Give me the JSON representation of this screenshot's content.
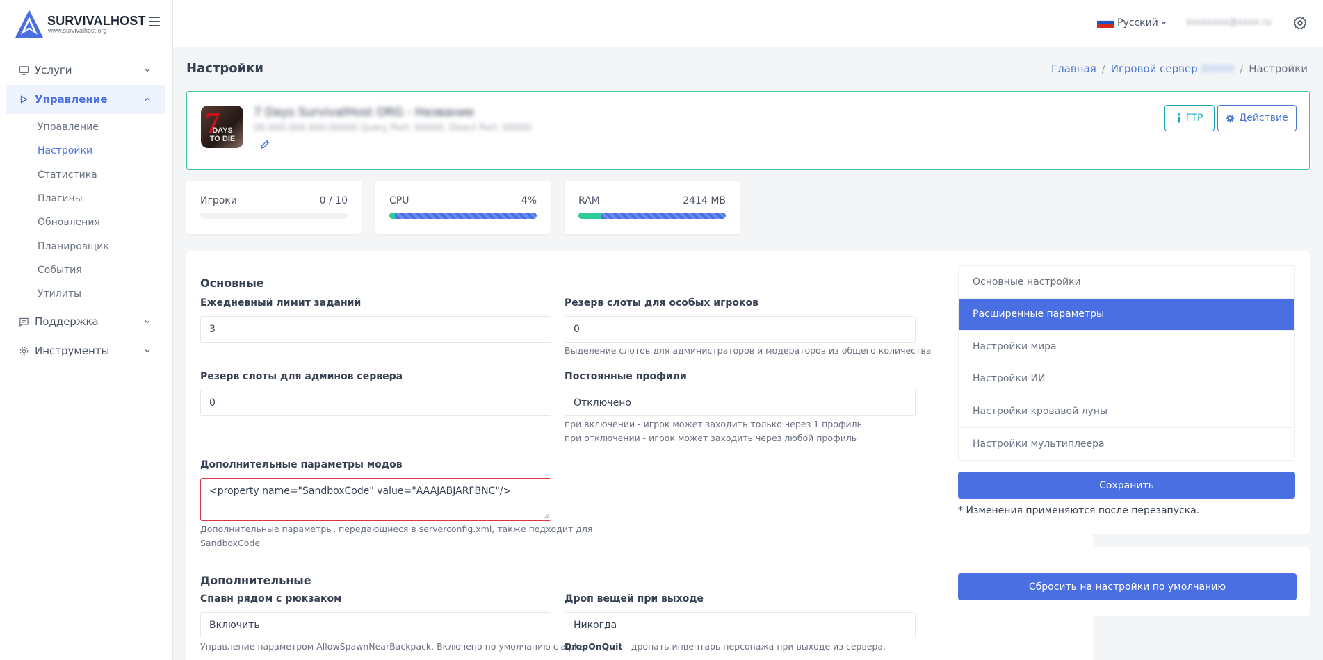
{
  "brand": {
    "name": "SURVIVALHOST",
    "url": "www.survivalhost.org"
  },
  "sidebar": {
    "items": [
      {
        "label": "Услуги"
      },
      {
        "label": "Управление"
      },
      {
        "label": "Поддержка"
      },
      {
        "label": "Инструменты"
      }
    ],
    "sub_items": [
      {
        "label": "Управление"
      },
      {
        "label": "Настройки"
      },
      {
        "label": "Статистика"
      },
      {
        "label": "Плагины"
      },
      {
        "label": "Обновления"
      },
      {
        "label": "Планировщик"
      },
      {
        "label": "События"
      },
      {
        "label": "Утилиты"
      }
    ]
  },
  "topbar": {
    "language": "Русский",
    "user": "xxxxxxxx@xxxx.ru"
  },
  "page": {
    "title": "Настройки"
  },
  "breadcrumb": {
    "home": "Главная",
    "server": "Игровой сервер",
    "server_id": "00000",
    "current": "Настройки",
    "sep": "/"
  },
  "server": {
    "name": "7 Days SurvivalHost ORG - Название",
    "address": "00.000.000.000:00000 Query Port: 00000, Direct Port: 00000",
    "image_text_top": "7",
    "image_text": "DAYS TO DIE",
    "ftp_label": "FTP",
    "action_label": "Действие"
  },
  "stats": {
    "players": {
      "label": "Игроки",
      "value": "0 / 10",
      "fraction": 0.0
    },
    "cpu": {
      "label": "CPU",
      "value": "4%",
      "fraction": 0.04
    },
    "ram": {
      "label": "RAM",
      "value": "2414 MB",
      "fraction": 0.15
    }
  },
  "form": {
    "section_main": "Основные",
    "daily_limit": {
      "label": "Ежедневный лимит заданий",
      "value": "3"
    },
    "reserved_special": {
      "label": "Резерв слоты для особых игроков",
      "value": "0",
      "help": "Выделение слотов для администраторов и модераторов из общего количества"
    },
    "reserved_admins": {
      "label": "Резерв слоты для админов сервера",
      "value": "0"
    },
    "persistent_profiles": {
      "label": "Постоянные профили",
      "value": "Отключено",
      "help1": "при включении - игрок может заходить только через 1 профиль",
      "help2": "при отключении - игрок может заходить через любой профиль"
    },
    "mods_params": {
      "label": "Дополнительные параметры модов",
      "value": "<property name=\"SandboxCode\" value=\"AAAJABJARFBNC\"/>",
      "help1": "Дополнительные параметры, передающиеся в serverconfig.xml, также подходит для",
      "help2": "SandboxCode"
    },
    "section_extra": "Дополнительные",
    "spawn_backpack": {
      "label": "Спавн рядом с рюкзаком",
      "value": "Включить",
      "help": "Управление параметром AllowSpawnNearBackpack. Включено по умолчанию с alpha"
    },
    "drop_on_quit": {
      "label": "Дроп вещей при выходе",
      "value": "Никогда",
      "help_key": "DropOnQuit",
      "help": " - дропать инвентарь персонажа при выходе из сервера."
    }
  },
  "settings_tabs": [
    {
      "label": "Основные настройки"
    },
    {
      "label": "Расширенные параметры"
    },
    {
      "label": "Настройки мира"
    },
    {
      "label": "Настройки ИИ"
    },
    {
      "label": "Настройки кровавой луны"
    },
    {
      "label": "Настройки мультиплеера"
    }
  ],
  "actions": {
    "save": "Сохранить",
    "note": "* Изменения применяются после перезапуска.",
    "reset": "Сбросить на настройки по умолчанию"
  },
  "colors": {
    "primary": "#4a6fe3",
    "success": "#2ecc9a",
    "info": "#17a2b8",
    "danger": "#dc3545"
  }
}
